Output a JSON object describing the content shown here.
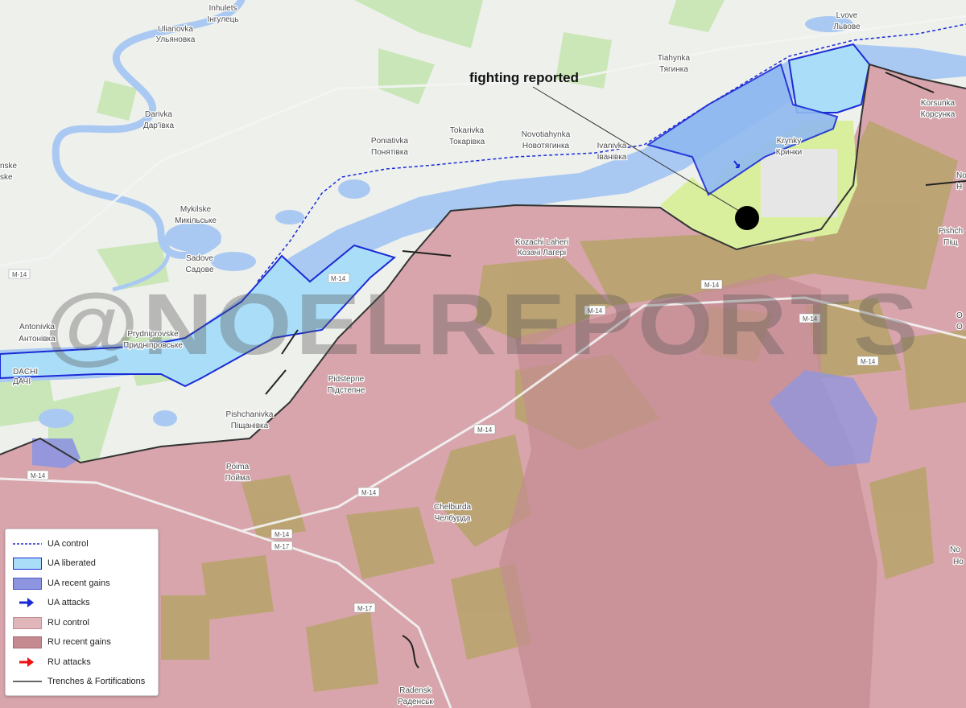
{
  "colors": {
    "land": "#eef0ec",
    "water": "#aac9f2",
    "green": "#c6e6b3",
    "ru_control": "#d7a5ab",
    "ru_recent": "#c58a90",
    "fields": "#b8a36a",
    "contested_green": "#d9ef9e",
    "ua_liberated": "#a9ddf8",
    "ua_recent": "#8e95e0",
    "ua_line": "#1a2bd6",
    "front_line": "#333333"
  },
  "watermark": "@NOELREPORTS",
  "annotation": {
    "text": "fighting reported"
  },
  "places": [
    {
      "key": "inhulets",
      "latin": "Inhulets",
      "cyrillic": "Інгулець"
    },
    {
      "key": "ulianovka",
      "latin": "Ulianovka",
      "cyrillic": "Ульяновка"
    },
    {
      "key": "lvove",
      "latin": "Lvove",
      "cyrillic": "Львове"
    },
    {
      "key": "tiahynka",
      "latin": "Tiahynka",
      "cyrillic": "Тягинка"
    },
    {
      "key": "korsunka",
      "latin": "Korsunka",
      "cyrillic": "Корсунка"
    },
    {
      "key": "darivka",
      "latin": "Darivka",
      "cyrillic": "Дар'ївка"
    },
    {
      "key": "poniativka",
      "latin": "Poniativka",
      "cyrillic": "Понятівка"
    },
    {
      "key": "tokarivka",
      "latin": "Tokarivka",
      "cyrillic": "Токарівка"
    },
    {
      "key": "novotiahynka",
      "latin": "Novotiahynka",
      "cyrillic": "Новотягинка"
    },
    {
      "key": "ivanivka",
      "latin": "Ivanivka",
      "cyrillic": "Іванівка"
    },
    {
      "key": "krynky",
      "latin": "Krynky",
      "cyrillic": "Кринки"
    },
    {
      "key": "mykilske",
      "latin": "Mykilske",
      "cyrillic": "Микільське"
    },
    {
      "key": "sadove",
      "latin": "Sadove",
      "cyrillic": "Садове"
    },
    {
      "key": "kozachi",
      "latin": "Kozachi Laheri",
      "cyrillic": "Козачі Лагері"
    },
    {
      "key": "antonivka",
      "latin": "Antonivka",
      "cyrillic": "Антонівка"
    },
    {
      "key": "prydniprovske",
      "latin": "Prydniprovske",
      "cyrillic": "Придніпровське"
    },
    {
      "key": "pidstepne",
      "latin": "Pidstepne",
      "cyrillic": "Підстепне"
    },
    {
      "key": "pishchanivka",
      "latin": "Pishchanivka",
      "cyrillic": "Піщанівка"
    },
    {
      "key": "poima",
      "latin": "Poima",
      "cyrillic": "Пойма"
    },
    {
      "key": "chelburda",
      "latin": "Chelburda",
      "cyrillic": "Челбурда"
    },
    {
      "key": "radensk",
      "latin": "Radensk",
      "cyrillic": "Раденськ"
    }
  ],
  "edge_fragments": {
    "left_nske": "nske",
    "left_ske": "ske",
    "right_no": "No",
    "right_n": "Н",
    "right_pishch": "Pishch",
    "right_pishch_cyr": "Піщ",
    "right_o": "O",
    "right_o2": "О",
    "right_no2": "No",
    "right_ho": "Но",
    "dachi": "DACHI",
    "dachi2": "ДАЧІ"
  },
  "roads": {
    "m14": "M-14",
    "m17": "M-17"
  },
  "legend": {
    "items": [
      {
        "key": "ua_control",
        "label": "UA control",
        "symbol": "dashed-line"
      },
      {
        "key": "ua_liberated",
        "label": "UA liberated",
        "symbol": "swatch"
      },
      {
        "key": "ua_recent",
        "label": "UA recent gains",
        "symbol": "swatch"
      },
      {
        "key": "ua_attacks",
        "label": "UA attacks",
        "symbol": "blue-arrow"
      },
      {
        "key": "ru_control",
        "label": "RU control",
        "symbol": "swatch"
      },
      {
        "key": "ru_recent",
        "label": "RU recent gains",
        "symbol": "swatch"
      },
      {
        "key": "ru_attacks",
        "label": "RU attacks",
        "symbol": "red-arrow"
      },
      {
        "key": "trenches",
        "label": "Trenches & Fortifications",
        "symbol": "line"
      }
    ]
  }
}
